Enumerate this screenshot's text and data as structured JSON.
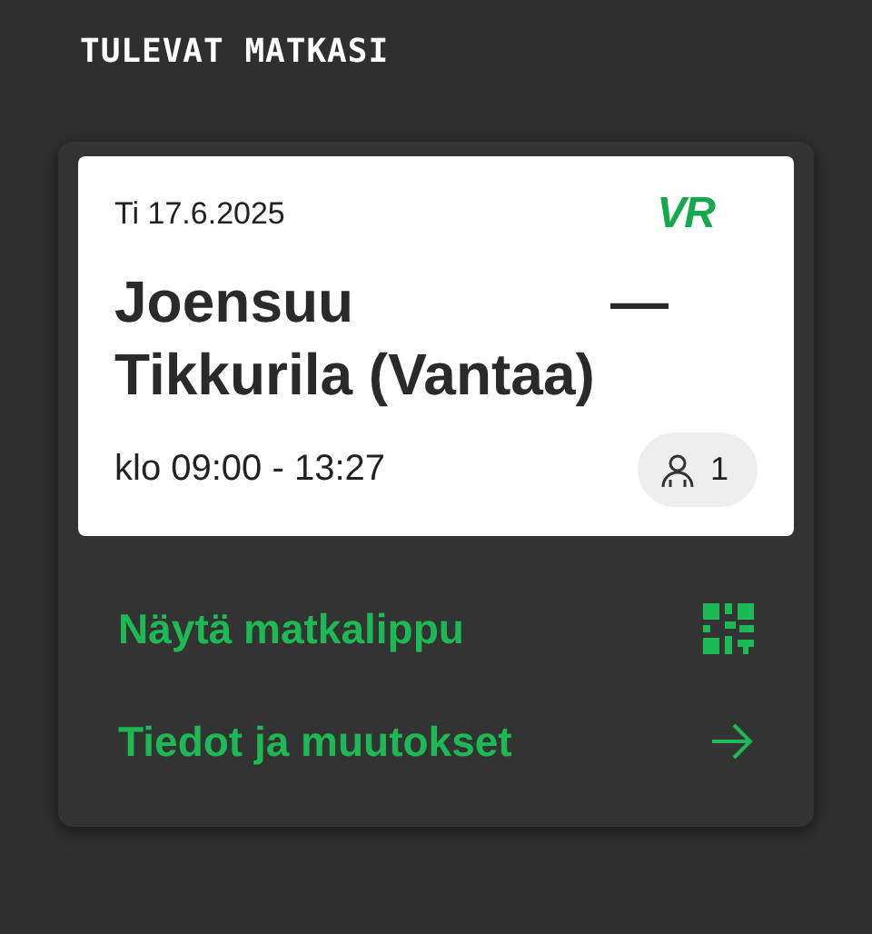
{
  "heading": "TULEVAT MATKASI",
  "trip": {
    "date": "Ti 17.6.2025",
    "logo": "VR",
    "route": "Joensuu — Tikkurila (Vantaa)",
    "time": "klo 09:00 - 13:27",
    "passengers": "1"
  },
  "actions": [
    {
      "label": "Näytä matkalippu",
      "kind": "qr"
    },
    {
      "label": "Tiedot ja muutokset",
      "kind": "arrow"
    }
  ]
}
